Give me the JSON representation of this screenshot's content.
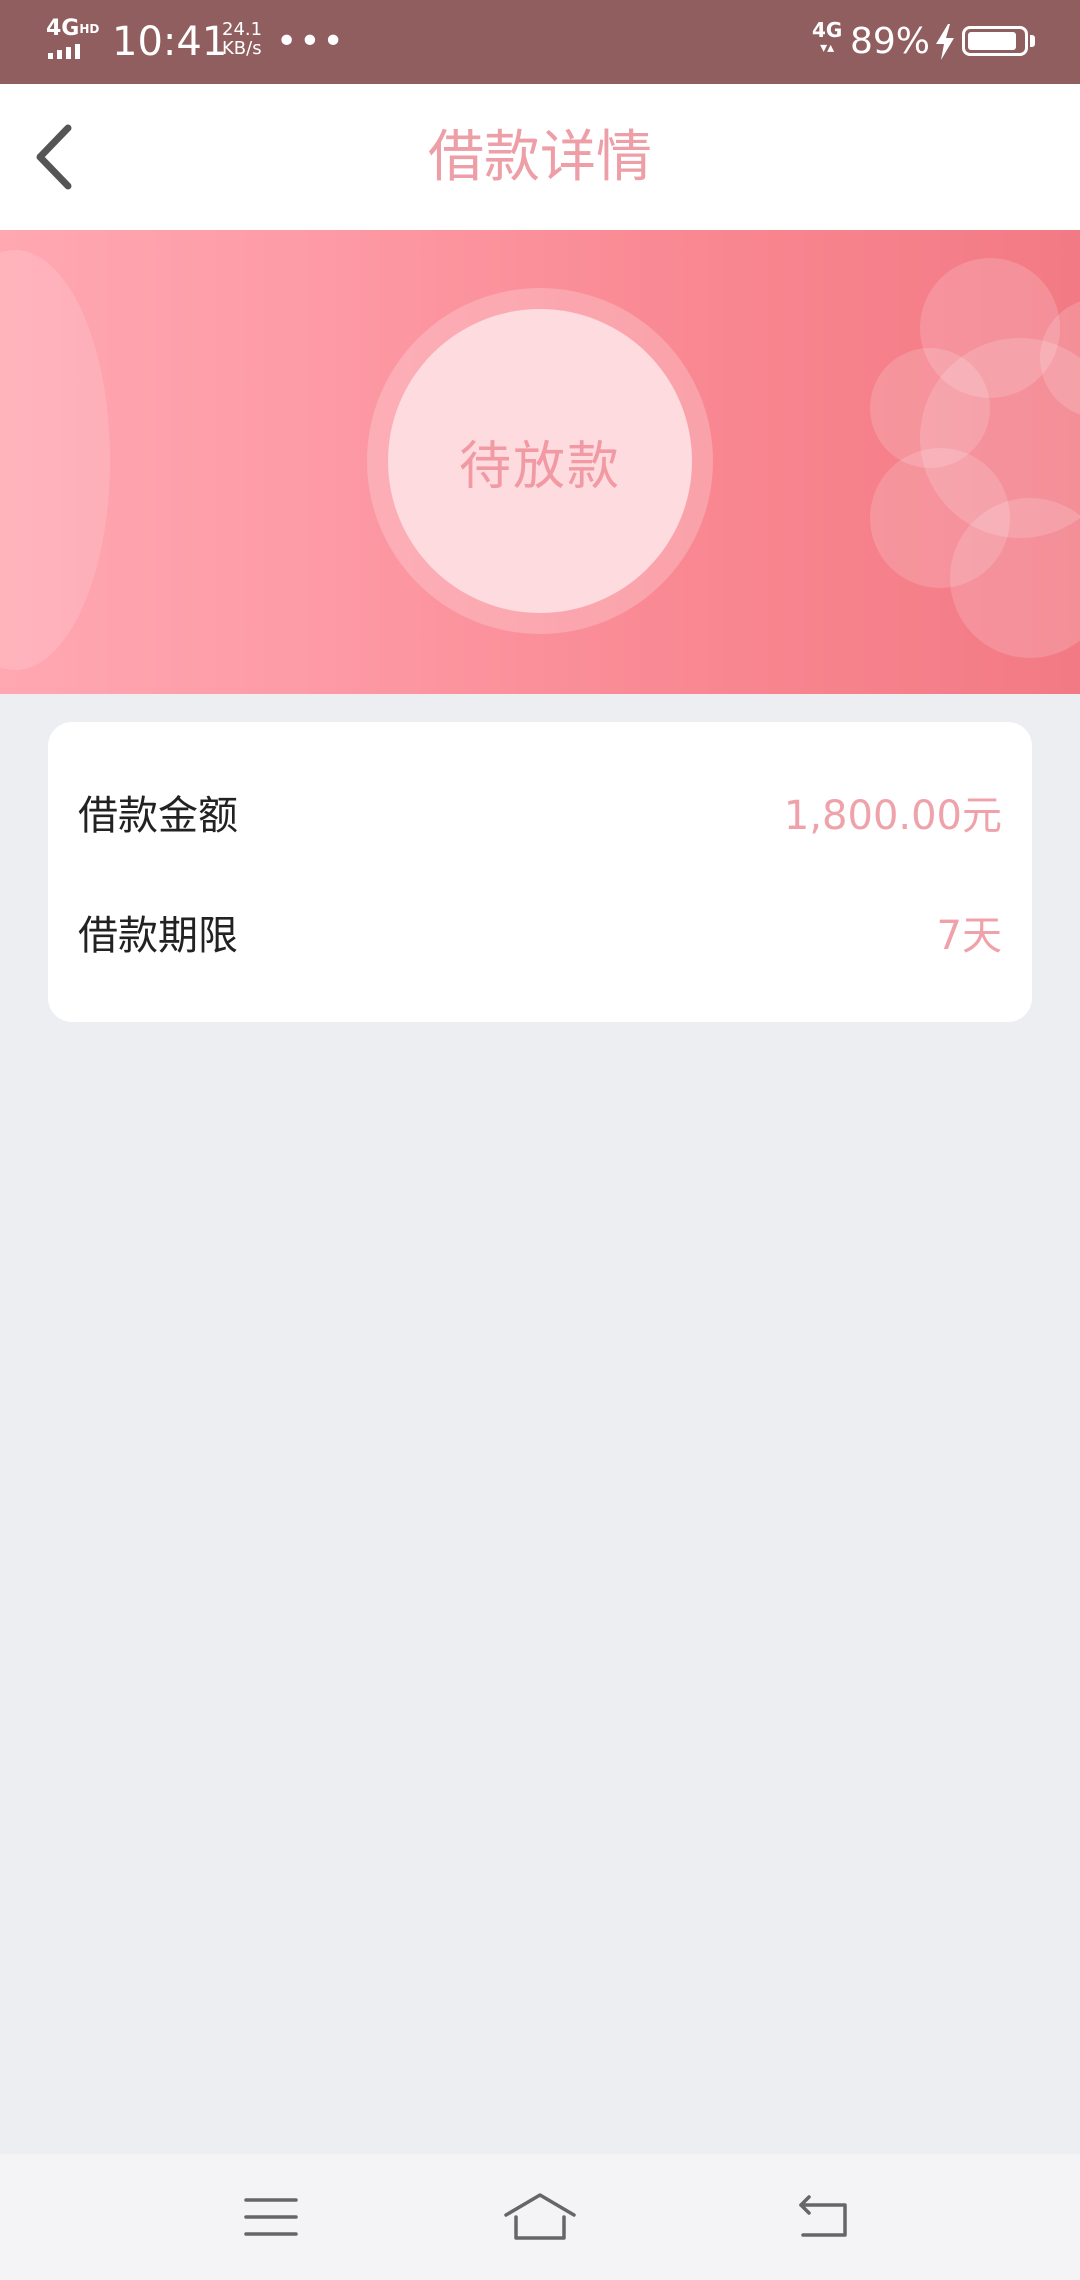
{
  "status_bar": {
    "network_left": "4G",
    "network_left_suffix": "HD",
    "time": "10:41",
    "speed_value": "24.1",
    "speed_unit": "KB/s",
    "more_dots": "•••",
    "network_right": "4G",
    "battery_percent": "89%",
    "battery_level": 0.89,
    "text_color": "#ffffff",
    "background_color": "#915e5f"
  },
  "header": {
    "title": "借款详情",
    "title_color": "#ee9ea7",
    "back_icon": "chevron-left-icon"
  },
  "hero": {
    "status_text": "待放款",
    "gradient_colors": [
      "#ffa8b2",
      "#f27a85"
    ]
  },
  "loan_details": {
    "rows": [
      {
        "label": "借款金额",
        "value": "1,800.00元"
      },
      {
        "label": "借款期限",
        "value": "7天"
      }
    ],
    "value_color": "#efa2a9"
  },
  "nav_bar": {
    "buttons": [
      "menu-icon",
      "home-icon",
      "return-icon"
    ]
  }
}
